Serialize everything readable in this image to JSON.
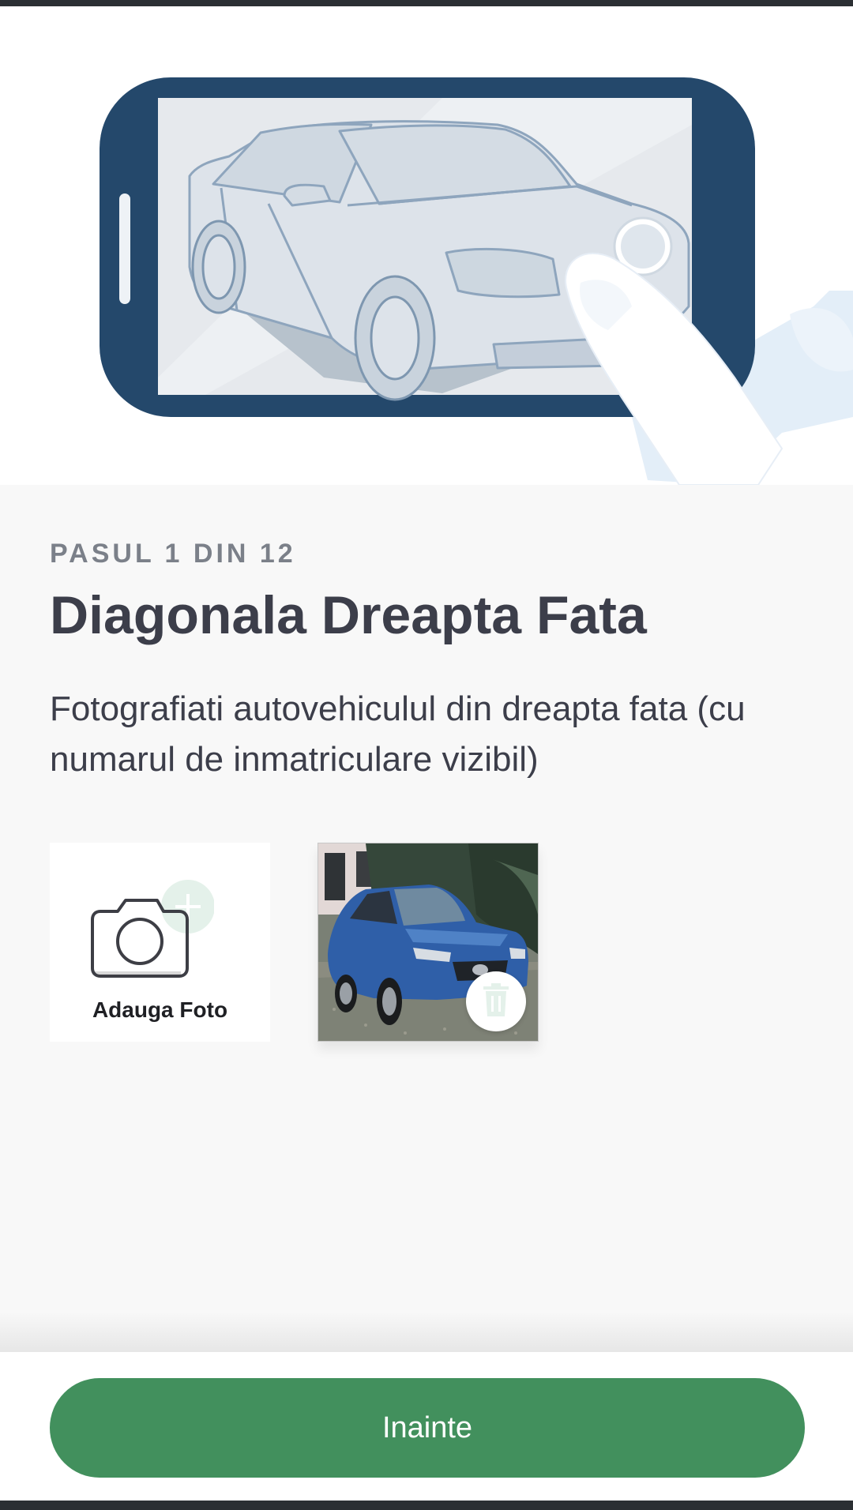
{
  "step": {
    "label": "PASUL 1 DIN 12",
    "title": "Diagonala Dreapta Fata",
    "description": "Fotografiati autovehiculul din dreapta fata (cu numarul de inmatriculare vizibil)"
  },
  "photos": {
    "add_label": "Adauga Foto",
    "icons": {
      "add": "camera-plus-icon",
      "delete": "trash-icon"
    }
  },
  "footer": {
    "next_label": "Inainte"
  },
  "colors": {
    "primary": "#42905d",
    "phone_frame": "#24486b",
    "text_dark": "#3c3e4a",
    "text_muted": "#7b8089",
    "background": "#f8f8f8",
    "accent_light": "#e4f1ea"
  }
}
